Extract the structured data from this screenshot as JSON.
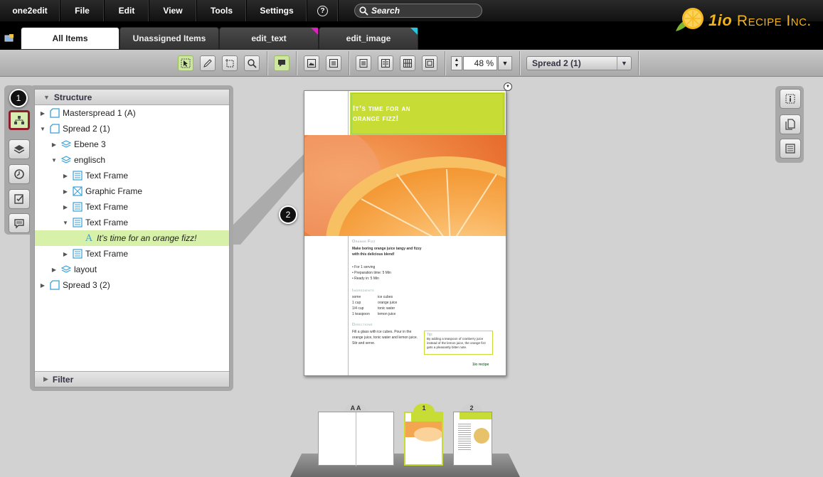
{
  "menubar": {
    "items": [
      "one2edit",
      "File",
      "Edit",
      "View",
      "Tools",
      "Settings"
    ],
    "help_label": "?",
    "search_placeholder": "Search"
  },
  "logo": {
    "prefix": "1io",
    "name": "Recipe Inc."
  },
  "tabs": [
    {
      "label": "All Items",
      "active": true
    },
    {
      "label": "Unassigned Items",
      "active": false
    },
    {
      "label": "edit_text",
      "corner_color": "#e020c0"
    },
    {
      "label": "edit_image",
      "corner_color": "#20c8e0"
    }
  ],
  "toolbar": {
    "zoom_value": "48 %",
    "spread_select": "Spread 2 (1)",
    "tool_icons": [
      "select-tool-icon",
      "pen-tool-icon",
      "crop-tool-icon",
      "zoom-tool-icon",
      "comment-tool-icon",
      "image-frame-icon",
      "text-frame-icon",
      "view-single-icon",
      "view-double-icon",
      "view-grid-icon",
      "view-fit-icon"
    ]
  },
  "callouts": {
    "one": "1",
    "two": "2"
  },
  "structure": {
    "title": "Structure",
    "filter_title": "Filter",
    "rows": [
      {
        "label": "Masterspread 1 (A)",
        "icon": "spread-icon",
        "expanded": false,
        "indent": 0
      },
      {
        "label": "Spread 2 (1)",
        "icon": "spread-icon",
        "expanded": true,
        "indent": 0
      },
      {
        "label": "Ebene 3",
        "icon": "layer-icon",
        "expanded": false,
        "indent": 1
      },
      {
        "label": "englisch",
        "icon": "layer-icon",
        "expanded": true,
        "indent": 1
      },
      {
        "label": "Text Frame",
        "icon": "text-frame-icon",
        "expanded": false,
        "indent": 2
      },
      {
        "label": "Graphic Frame",
        "icon": "graphic-frame-icon",
        "expanded": false,
        "indent": 2
      },
      {
        "label": "Text Frame",
        "icon": "text-frame-icon",
        "expanded": false,
        "indent": 2
      },
      {
        "label": "Text Frame",
        "icon": "text-frame-icon",
        "expanded": true,
        "indent": 2
      },
      {
        "label": "It’s time for an  orange fizz!",
        "icon": "text-content-icon",
        "expanded": null,
        "indent": 3,
        "selected": true
      },
      {
        "label": "Text Frame",
        "icon": "text-frame-icon",
        "expanded": false,
        "indent": 2
      },
      {
        "label": "layout",
        "icon": "layer-icon",
        "expanded": false,
        "indent": 1
      },
      {
        "label": "Spread 3 (2)",
        "icon": "spread-icon",
        "expanded": false,
        "indent": 0
      }
    ]
  },
  "page": {
    "headline_line1": "It’s time for an",
    "headline_line2": "orange fizz!",
    "recipe_title": "Orange Fizz",
    "intro": "Make boring orange juice tangy and fizzy with this delicious blend!",
    "facts": [
      "• For 1 serving",
      "• Preparation time: 5 Min",
      "• Ready in: 5 Min"
    ],
    "ingredients_title": "Ingredients",
    "ingredients": [
      [
        "some",
        "ice cubes"
      ],
      [
        "1 cup",
        "orange juice"
      ],
      [
        "1/4 cup",
        "tonic water"
      ],
      [
        "1 teaspoon",
        "lemon juice"
      ]
    ],
    "directions_title": "Directions",
    "directions": "Fill a glass with ice cubes. Pour in the orange juice, tonic water and lemon juice. Stir and serve.",
    "tip_title": "Tip:",
    "tip": "By adding a teaspoon of cranberry juice instead of the lemon juice, the orange fizz gets a pleasantly bitter note.",
    "footer_logo": "1io recipe"
  },
  "thumbnails": [
    {
      "label": "A A"
    },
    {
      "label": "1",
      "active": true
    },
    {
      "label": "2"
    }
  ],
  "colors": {
    "accent_green": "#c7dc35",
    "selection_green": "#d7f2a8",
    "active_outline": "#8b1e2a",
    "logo_orange": "#f2b21a"
  }
}
